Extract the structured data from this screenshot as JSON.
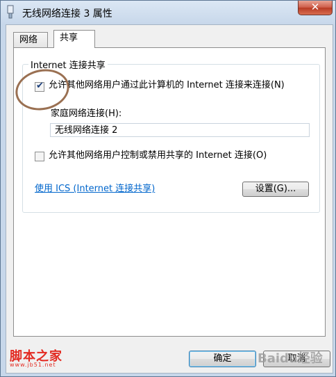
{
  "window": {
    "title": "无线网络连接 3 属性",
    "close_label": "✕"
  },
  "tabs": [
    {
      "label": "网络"
    },
    {
      "label": "共享"
    }
  ],
  "group": {
    "legend": "Internet 连接共享"
  },
  "allow_share": {
    "label": "允许其他网络用户通过此计算机的 Internet 连接来连接(N)",
    "checked": true
  },
  "home_network": {
    "label": "家庭网络连接(H):",
    "value": "无线网络连接 2"
  },
  "allow_control": {
    "label": "允许其他网络用户控制或禁用共享的 Internet 连接(O)",
    "checked": false
  },
  "ics_link": "使用 ICS (Internet 连接共享)",
  "buttons": {
    "settings": "设置(G)...",
    "ok": "确定",
    "cancel": "取消"
  },
  "watermark": {
    "left": "脚本之家",
    "url": "www.jb51.net",
    "right": "Baidu经验"
  },
  "colors": {
    "accent": "#0066cc",
    "annotation": "#9a7052",
    "watermark": "#e32b22"
  }
}
